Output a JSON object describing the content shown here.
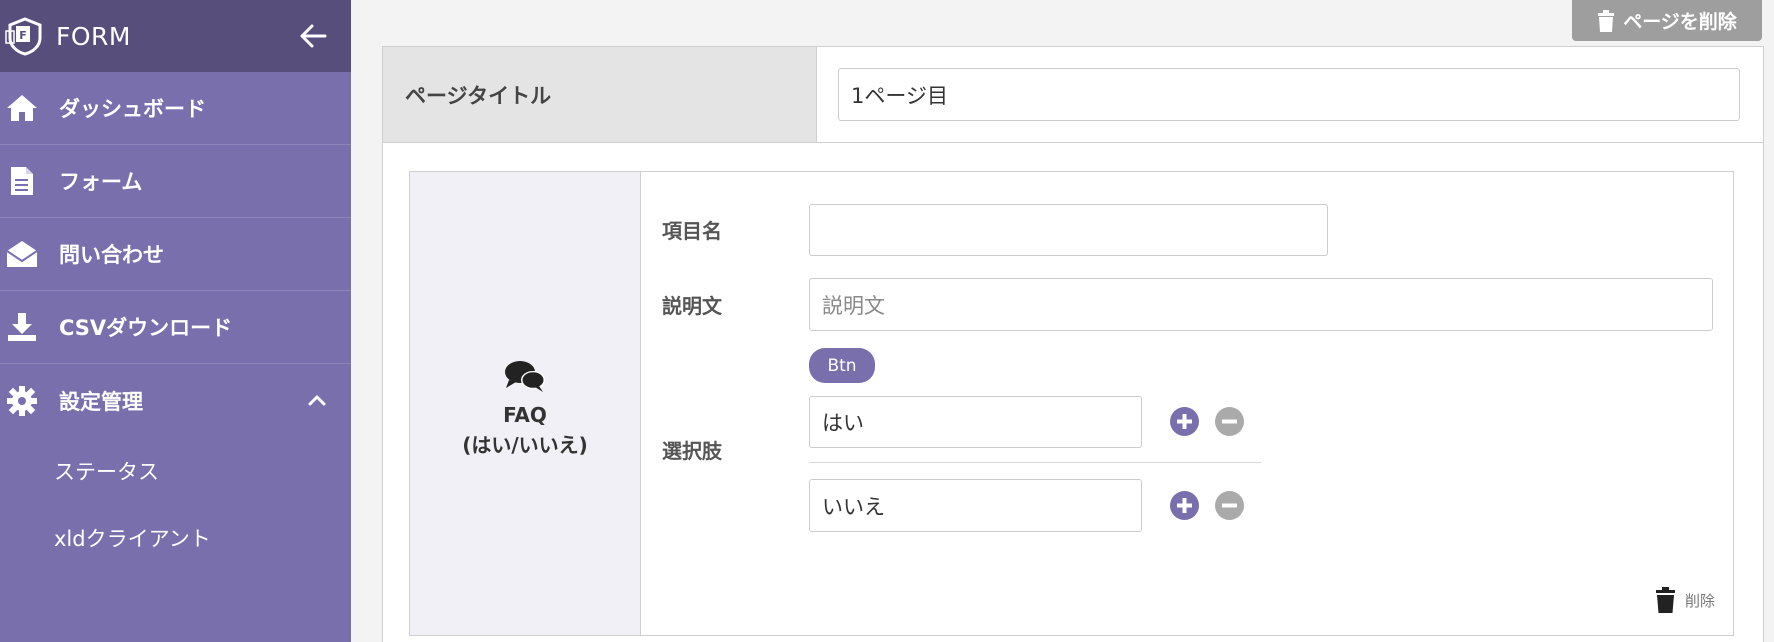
{
  "sidebar": {
    "brand": "FORM",
    "items": [
      {
        "label": "ダッシュボード",
        "icon": "home-icon"
      },
      {
        "label": "フォーム",
        "icon": "document-icon"
      },
      {
        "label": "問い合わせ",
        "icon": "inbox-icon"
      },
      {
        "label": "CSVダウンロード",
        "icon": "download-icon"
      },
      {
        "label": "設定管理",
        "icon": "gear-icon"
      }
    ],
    "sub_items": [
      {
        "label": "ステータス"
      },
      {
        "label": "xldクライアント"
      }
    ]
  },
  "toolbar": {
    "delete_page_label": "ページを削除"
  },
  "page": {
    "title_label": "ページタイトル",
    "title_value": "1ページ目"
  },
  "item": {
    "type_name_line1": "FAQ",
    "type_name_line2": "(はい/いいえ)",
    "name_label": "項目名",
    "name_value": "",
    "description_label": "説明文",
    "description_placeholder": "説明文",
    "btn_label": "Btn",
    "choices_label": "選択肢",
    "choices": [
      {
        "value": "はい"
      },
      {
        "value": "いいえ"
      }
    ],
    "delete_label": "削除"
  },
  "colors": {
    "sidebar": "#7a6fad",
    "sidebar_header": "#574e7b",
    "accent": "#7a6fad"
  }
}
